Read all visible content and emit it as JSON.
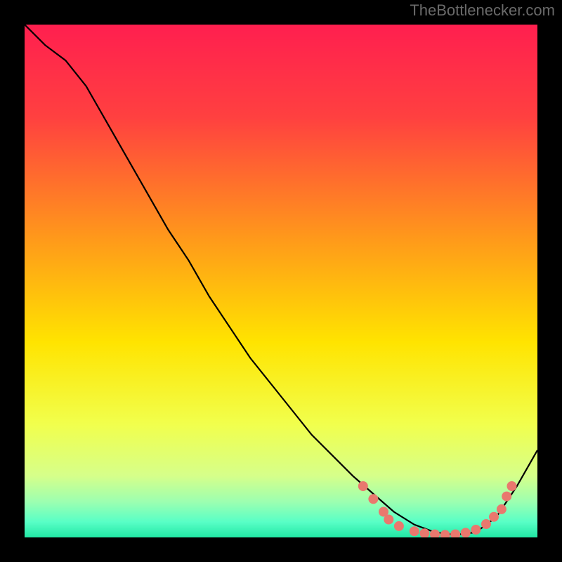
{
  "attribution": "TheBottlenecker.com",
  "chart_data": {
    "type": "line",
    "title": "",
    "xlabel": "",
    "ylabel": "",
    "xlim": [
      0,
      100
    ],
    "ylim": [
      0,
      100
    ],
    "gradient_stops": [
      {
        "offset": 0,
        "color": "#ff1f4f"
      },
      {
        "offset": 0.18,
        "color": "#ff4040"
      },
      {
        "offset": 0.42,
        "color": "#ff9a1a"
      },
      {
        "offset": 0.62,
        "color": "#ffe400"
      },
      {
        "offset": 0.78,
        "color": "#f1ff4d"
      },
      {
        "offset": 0.88,
        "color": "#d6ff8a"
      },
      {
        "offset": 0.93,
        "color": "#9dffb0"
      },
      {
        "offset": 0.97,
        "color": "#58ffc6"
      },
      {
        "offset": 1.0,
        "color": "#21e7a5"
      }
    ],
    "series": [
      {
        "name": "bottleneck-curve",
        "color": "#000000",
        "x": [
          0,
          4,
          8,
          12,
          16,
          20,
          24,
          28,
          32,
          36,
          40,
          44,
          48,
          52,
          56,
          60,
          64,
          68,
          72,
          76,
          80,
          84,
          88,
          92,
          96,
          100
        ],
        "y": [
          100,
          96,
          93,
          88,
          81,
          74,
          67,
          60,
          54,
          47,
          41,
          35,
          30,
          25,
          20,
          16,
          12,
          8.5,
          5,
          2.5,
          1,
          0.5,
          1,
          4,
          10,
          17
        ]
      }
    ],
    "markers": {
      "name": "highlight-points",
      "color": "#e9786e",
      "radius": 7,
      "points": [
        {
          "x": 66,
          "y": 10
        },
        {
          "x": 68,
          "y": 7.5
        },
        {
          "x": 70,
          "y": 5
        },
        {
          "x": 71,
          "y": 3.5
        },
        {
          "x": 73,
          "y": 2.2
        },
        {
          "x": 76,
          "y": 1.2
        },
        {
          "x": 78,
          "y": 0.8
        },
        {
          "x": 80,
          "y": 0.6
        },
        {
          "x": 82,
          "y": 0.5
        },
        {
          "x": 84,
          "y": 0.6
        },
        {
          "x": 86,
          "y": 0.9
        },
        {
          "x": 88,
          "y": 1.5
        },
        {
          "x": 90,
          "y": 2.6
        },
        {
          "x": 91.5,
          "y": 4
        },
        {
          "x": 93,
          "y": 5.5
        },
        {
          "x": 94,
          "y": 8
        },
        {
          "x": 95,
          "y": 10
        }
      ]
    }
  }
}
